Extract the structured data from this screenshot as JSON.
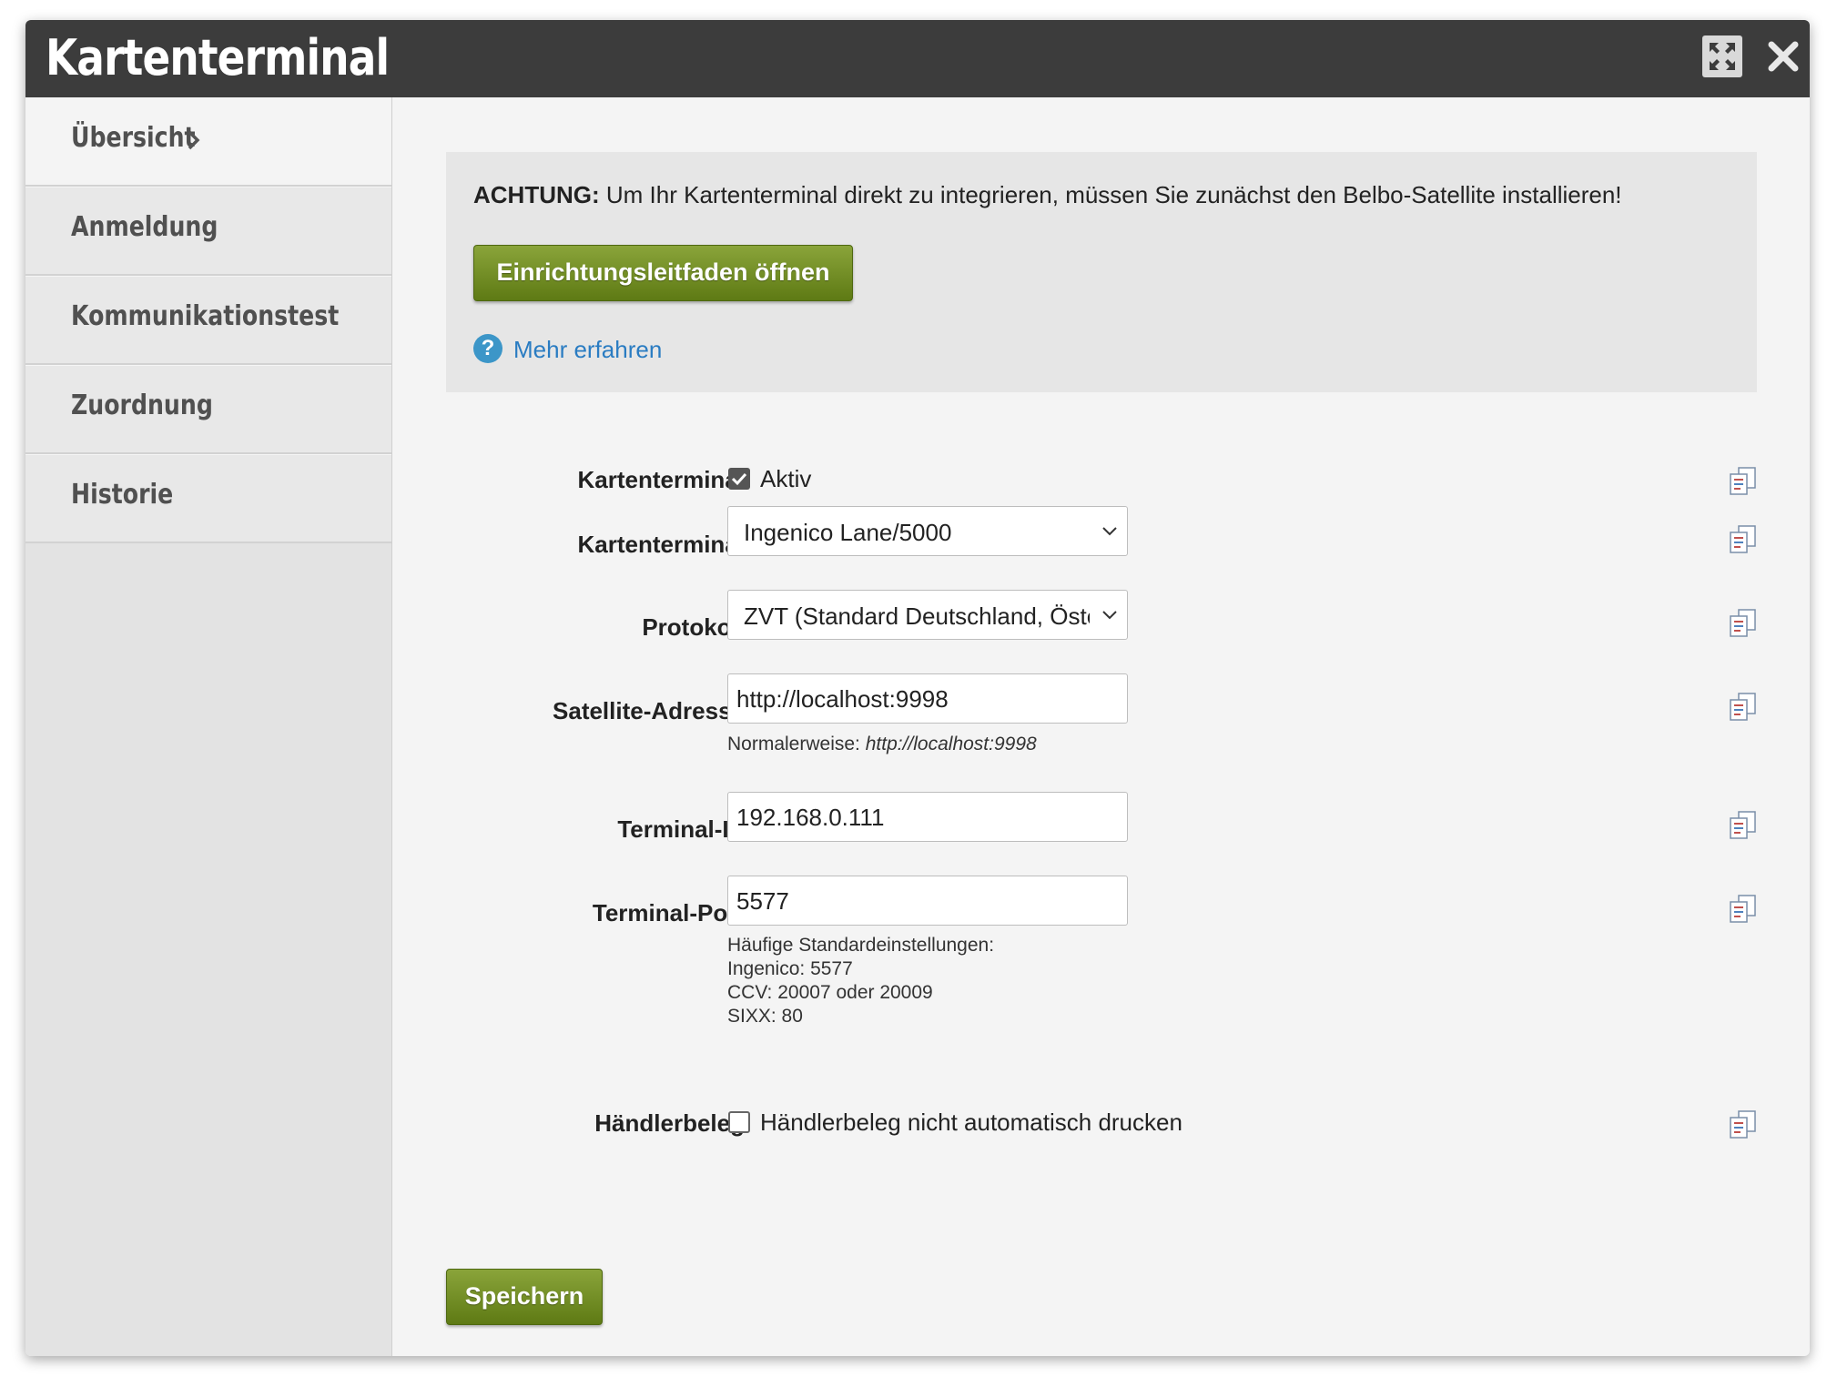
{
  "window": {
    "title": "Kartenterminal",
    "maximize_icon": "maximize-icon",
    "close_icon": "close-icon"
  },
  "sidebar": {
    "items": [
      {
        "label": "Übersicht",
        "active": true
      },
      {
        "label": "Anmeldung",
        "active": false
      },
      {
        "label": "Kommunikationstest",
        "active": false
      },
      {
        "label": "Zuordnung",
        "active": false
      },
      {
        "label": "Historie",
        "active": false
      }
    ]
  },
  "notice": {
    "bold": "ACHTUNG:",
    "text": " Um Ihr Kartenterminal direkt zu integrieren, müssen Sie zunächst den Belbo-Satellite installieren!",
    "guide_button": "Einrichtungsleitfaden öffnen",
    "help_icon": "?",
    "help_link": "Mehr erfahren"
  },
  "form": {
    "active": {
      "label": "Kartenterminal",
      "checkbox_label": "Aktiv",
      "checked": true
    },
    "terminal": {
      "label": "Kartenterminal",
      "value": "Ingenico Lane/5000"
    },
    "protocol": {
      "label": "Protokoll",
      "value": "ZVT (Standard Deutschland, Österreich)"
    },
    "satellite": {
      "label": "Satellite-Adresse",
      "value": "http://localhost:9998",
      "hint_prefix": "Normalerweise:",
      "hint_value": "http://localhost:9998"
    },
    "terminal_ip": {
      "label": "Terminal-IP",
      "value": "192.168.0.111"
    },
    "terminal_port": {
      "label": "Terminal-Port",
      "value": "5577",
      "hints": [
        "Häufige Standardeinstellungen:",
        "Ingenico: 5577",
        "CCV: 20007 oder 20009",
        "SIXX: 80"
      ]
    },
    "merchant_receipt": {
      "label": "Händlerbeleg",
      "checkbox_label": "Händlerbeleg nicht automatisch drucken",
      "checked": false
    }
  },
  "save_button": "Speichern",
  "colors": {
    "titlebar": "#3c3c3c",
    "button_green": "#6f8a22",
    "link_blue": "#2a7cc2"
  }
}
